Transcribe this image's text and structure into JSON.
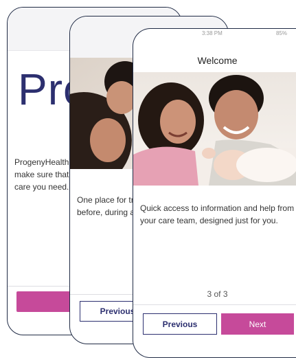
{
  "screen1": {
    "hero_text": "Pro",
    "body_text": "ProgenyHealth w\nmake sure that y\ncare you need."
  },
  "screen2": {
    "body_text": "One place for tru\nbefore, during an",
    "previous_label": "Previous"
  },
  "screen3": {
    "status_time": "3:38 PM",
    "status_battery": "85%",
    "title": "Welcome",
    "body_text": "Quick access to information and help from your care team, designed just for you.",
    "page_indicator": "3 of 3",
    "previous_label": "Previous",
    "next_label": "Next"
  },
  "colors": {
    "brand_navy": "#2c2f6f",
    "brand_pink": "#c64a9a"
  }
}
